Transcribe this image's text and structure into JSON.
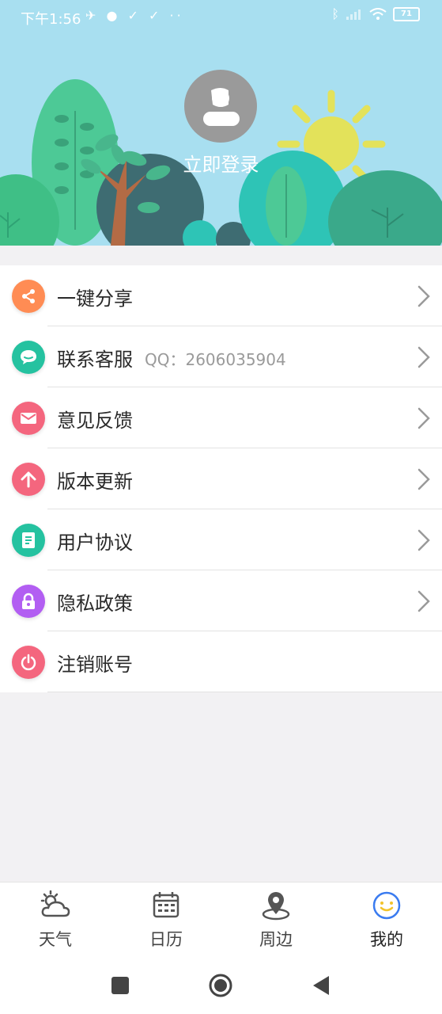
{
  "status_bar": {
    "time": "下午1:56",
    "left_icons": "✈ ● ✓ ✓ ··",
    "battery": "71"
  },
  "profile": {
    "login_label": "立即登录"
  },
  "menu": {
    "items": [
      {
        "label": "一键分享",
        "sub": "",
        "icon": "share-icon",
        "color": "#ff8c54",
        "chevron": true
      },
      {
        "label": "联系客服",
        "sub": "QQ：2606035904",
        "icon": "chat-icon",
        "color": "#25c2a0",
        "chevron": true
      },
      {
        "label": "意见反馈",
        "sub": "",
        "icon": "mail-icon",
        "color": "#f4667e",
        "chevron": true
      },
      {
        "label": "版本更新",
        "sub": "",
        "icon": "upload-arrow-icon",
        "color": "#f4667e",
        "chevron": true
      },
      {
        "label": "用户协议",
        "sub": "",
        "icon": "document-icon",
        "color": "#25c2a0",
        "chevron": true
      },
      {
        "label": "隐私政策",
        "sub": "",
        "icon": "lock-icon",
        "color": "#b25ef2",
        "chevron": true
      },
      {
        "label": "注销账号",
        "sub": "",
        "icon": "power-icon",
        "color": "#f4667e",
        "chevron": false
      }
    ]
  },
  "bottom_nav": {
    "items": [
      {
        "label": "天气",
        "icon": "weather-icon",
        "active": false
      },
      {
        "label": "日历",
        "icon": "calendar-icon",
        "active": false
      },
      {
        "label": "周边",
        "icon": "location-pin-icon",
        "active": false
      },
      {
        "label": "我的",
        "icon": "smiley-face-icon",
        "active": true
      }
    ]
  },
  "colors": {
    "header_bg": "#a8dff0",
    "accent_blue": "#3a7bf0"
  }
}
